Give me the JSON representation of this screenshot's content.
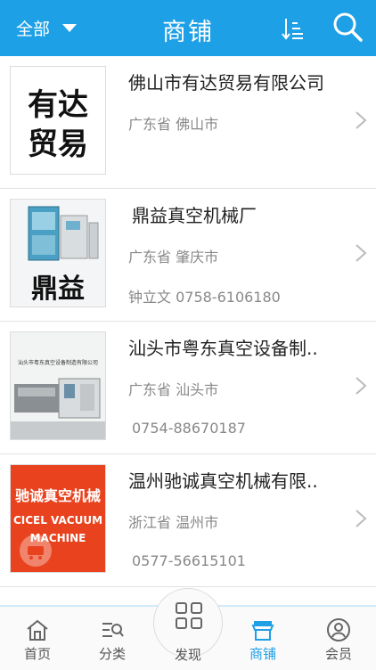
{
  "header": {
    "filter_label": "全部",
    "title": "商铺",
    "accent": "#1ea0e6"
  },
  "stores": [
    {
      "name": "佛山市有达贸易有限公司",
      "location": "广东省 佛山市",
      "contact": "",
      "logo_text_top": "有达",
      "logo_text_bottom": "贸易"
    },
    {
      "name": "鼎益真空机械厂",
      "location": "广东省 肇庆市",
      "contact": "钟立文 0758-6106180",
      "logo_text_bottom": "鼎益"
    },
    {
      "name": "汕头市粤东真空设备制..",
      "location": "广东省 汕头市",
      "contact": "0754-88670187",
      "logo_caption": "汕头市粤东真空设备制造有限公司"
    },
    {
      "name": "温州驰诚真空机械有限..",
      "location": "浙江省 温州市",
      "contact": "0577-56615101",
      "logo_text_top": "驰诚真空机械",
      "logo_text_mid": "CICEL VACUUM",
      "logo_text_bottom": "MACHINE"
    }
  ],
  "nav": {
    "home": "首页",
    "category": "分类",
    "discover": "发现",
    "stores": "商铺",
    "member": "会员",
    "active": "stores"
  }
}
